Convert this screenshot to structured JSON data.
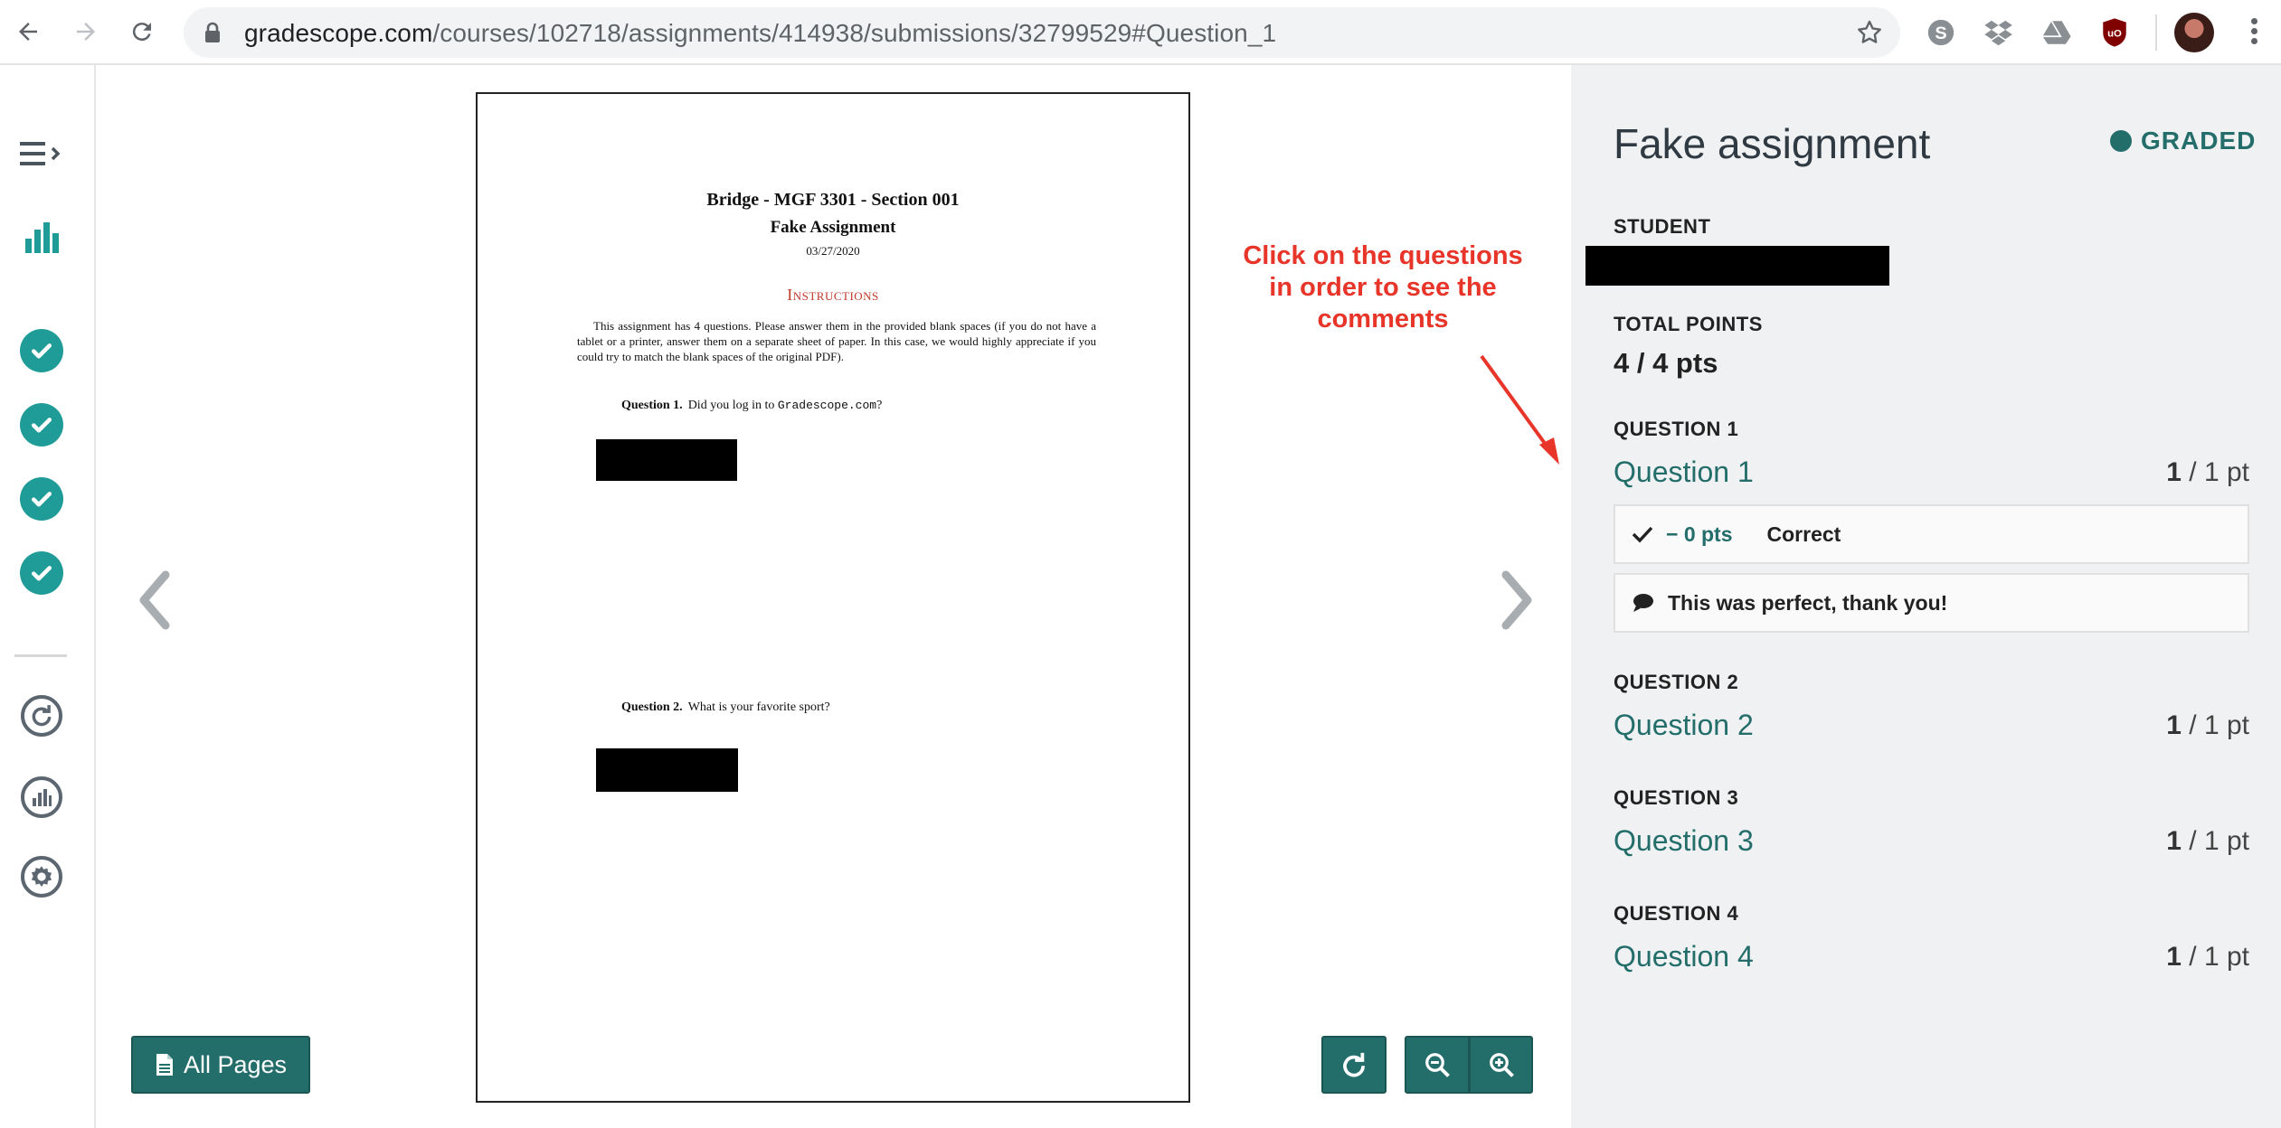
{
  "browser": {
    "url_host": "gradescope.com",
    "url_path": "/courses/102718/assignments/414938/submissions/32799529#Question_1"
  },
  "document": {
    "title": "Bridge - MGF 3301 - Section 001",
    "subtitle": "Fake Assignment",
    "date": "03/27/2020",
    "instructions_heading": "Instructions",
    "instructions_body": "This assignment has 4 questions. Please answer them in the provided blank spaces (if you do not have a tablet or a printer, answer them on a separate sheet of paper. In this case, we would highly appreciate if you could try to match the blank spaces of the original PDF).",
    "q1_label": "Question 1.",
    "q1_text": "Did you log in to",
    "q1_mono": "Gradescope.com",
    "q1_end": "?",
    "q2_label": "Question 2.",
    "q2_text": "What is your favorite sport?"
  },
  "annotation": {
    "text": "Click on the questions in order to see the comments",
    "color": "#e8352a"
  },
  "viewer": {
    "all_pages_label": "All Pages"
  },
  "panel": {
    "assignment_title": "Fake assignment",
    "status": "GRADED",
    "student_label": "STUDENT",
    "total_points_label": "TOTAL POINTS",
    "total_points": "4 / 4 pts",
    "questions": [
      {
        "heading": "QUESTION 1",
        "link": "Question 1",
        "earned": "1",
        "possible": " / 1 pt"
      },
      {
        "heading": "QUESTION 2",
        "link": "Question 2",
        "earned": "1",
        "possible": " / 1 pt"
      },
      {
        "heading": "QUESTION 3",
        "link": "Question 3",
        "earned": "1",
        "possible": " / 1 pt"
      },
      {
        "heading": "QUESTION 4",
        "link": "Question 4",
        "earned": "1",
        "possible": " / 1 pt"
      }
    ],
    "rubric": {
      "points": "− 0 pts",
      "description": "Correct"
    },
    "comment": "This was perfect, thank you!"
  },
  "colors": {
    "accent": "#236d6b",
    "check": "#1f9c98",
    "panel_bg": "#f0f1f2"
  }
}
